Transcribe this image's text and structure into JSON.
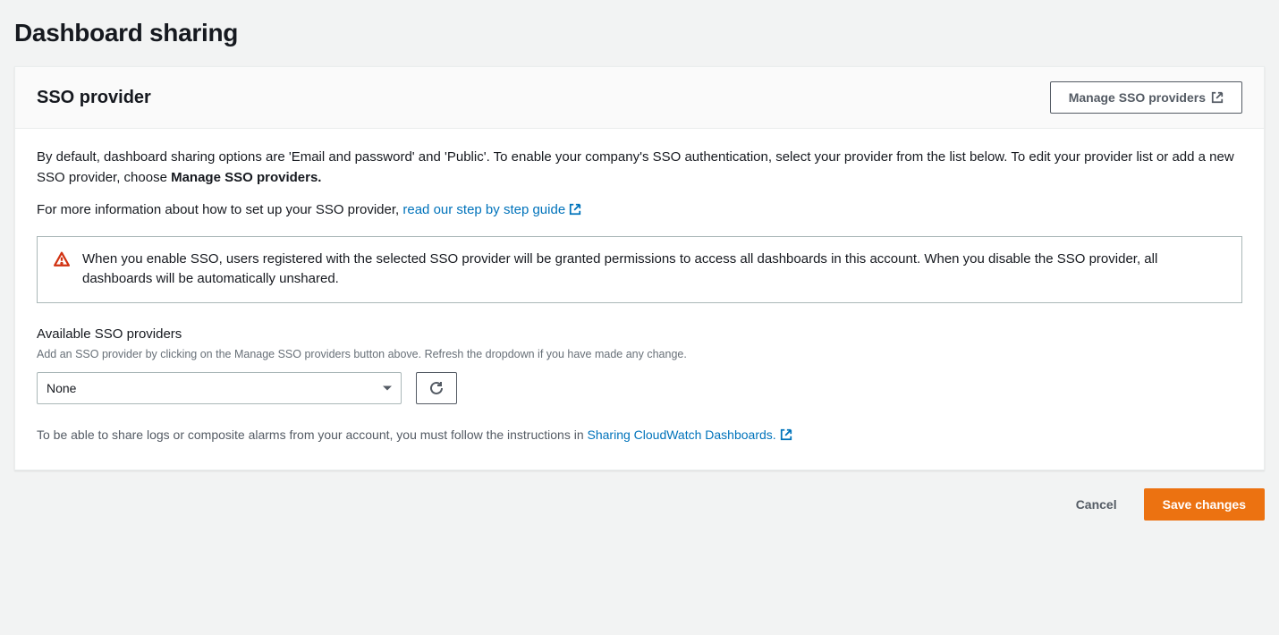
{
  "page": {
    "title": "Dashboard sharing"
  },
  "header": {
    "section_title": "SSO provider",
    "manage_button": "Manage SSO providers"
  },
  "description": {
    "line1_prefix": "By default, dashboard sharing options are 'Email and password' and 'Public'. To enable your company's SSO authentication, select your provider from the list below. To edit your provider list or add a new SSO provider, choose ",
    "line1_bold": "Manage SSO providers.",
    "line2_prefix": "For more information about how to set up your SSO provider, ",
    "line2_link": "read our step by step guide"
  },
  "alert": {
    "text": "When you enable SSO, users registered with the selected SSO provider will be granted permissions to access all dashboards in this account. When you disable the SSO provider, all dashboards will be automatically unshared."
  },
  "field": {
    "label": "Available SSO providers",
    "hint": "Add an SSO provider by clicking on the Manage SSO providers button above. Refresh the dropdown if you have made any change.",
    "selected": "None"
  },
  "footnote": {
    "prefix": "To be able to share logs or composite alarms from your account, you must follow the instructions in ",
    "link": "Sharing CloudWatch Dashboards."
  },
  "actions": {
    "cancel": "Cancel",
    "save": "Save changes"
  }
}
